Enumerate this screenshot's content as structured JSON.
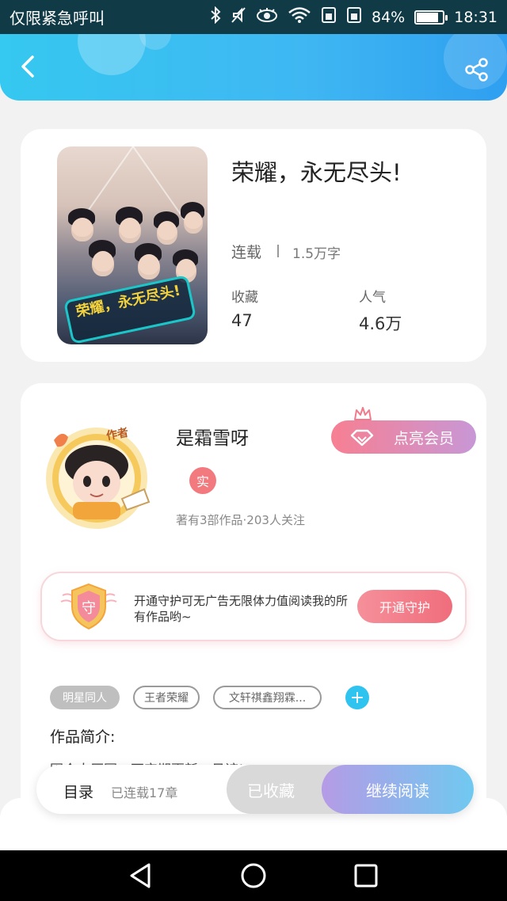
{
  "status_bar": {
    "carrier": "仅限紧急呼叫",
    "battery_percent": "84%",
    "battery_level": 0.84,
    "time": "18:31",
    "icons": [
      "bluetooth-icon",
      "mute-icon",
      "eye-icon",
      "wifi-icon",
      "sim-icon",
      "sim-icon",
      "battery-icon"
    ]
  },
  "header": {
    "back_icon": "chevron-left-icon",
    "share_icon": "share-icon",
    "accent_color": "#3fb7f2"
  },
  "book": {
    "title": "荣耀，永无尽头!",
    "cover_banner": "荣耀，永无尽头!",
    "status": "连载",
    "word_count": "1.5万字",
    "favorites_label": "收藏",
    "favorites_value": "47",
    "popularity_label": "人气",
    "popularity_value": "4.6万"
  },
  "author": {
    "avatar_tag": "作者",
    "name": "是霜雪呀",
    "real_badge": "实",
    "meta": "著有3部作品·203人关注",
    "vip_button": "点亮会员"
  },
  "guard": {
    "icon_char": "守",
    "text": "开通守护可无广告无限体力值阅读我的所有作品哟~",
    "button": "开通守护"
  },
  "tags": [
    "明星同人",
    "王者荣耀",
    "文轩祺鑫翔霖..."
  ],
  "intro": {
    "heading": "作品简介:",
    "text": "因个人原因，不定期更新，见谅!"
  },
  "bottom_bar": {
    "toc_label": "目录",
    "toc_count": "已连载17章",
    "collected_button": "已收藏",
    "read_button": "继续阅读"
  },
  "nav_bar": {
    "icons": [
      "back-triangle-icon",
      "home-circle-icon",
      "recents-square-icon"
    ]
  }
}
